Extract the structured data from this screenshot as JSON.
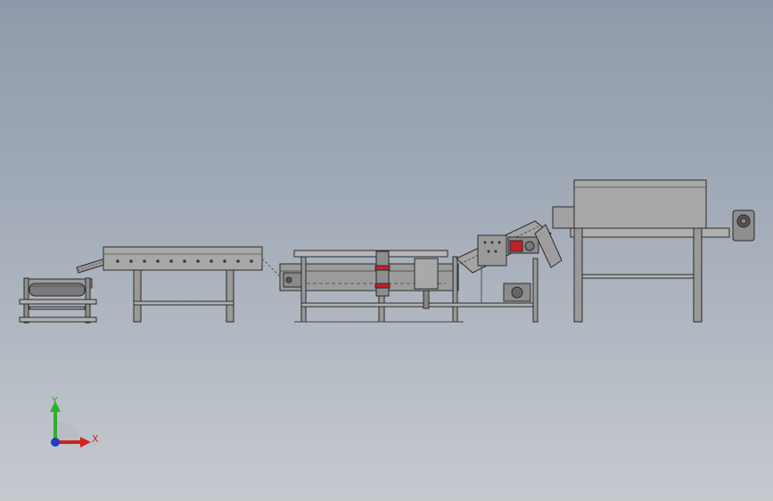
{
  "viewport": {
    "background_top": "#8e9aab",
    "background_bottom": "#c6cacf"
  },
  "triad": {
    "y_label": "Y",
    "x_label": "X",
    "colors": {
      "x": "#d0241e",
      "y": "#2fae2f",
      "z": "#1f3fbf"
    }
  },
  "model": {
    "machines": [
      "feed-roller-unit",
      "inclined-chain-conveyor",
      "long-roller-conveyor",
      "mid-frame-conveyor",
      "incline-elevator",
      "hood-machine",
      "end-motor"
    ]
  }
}
